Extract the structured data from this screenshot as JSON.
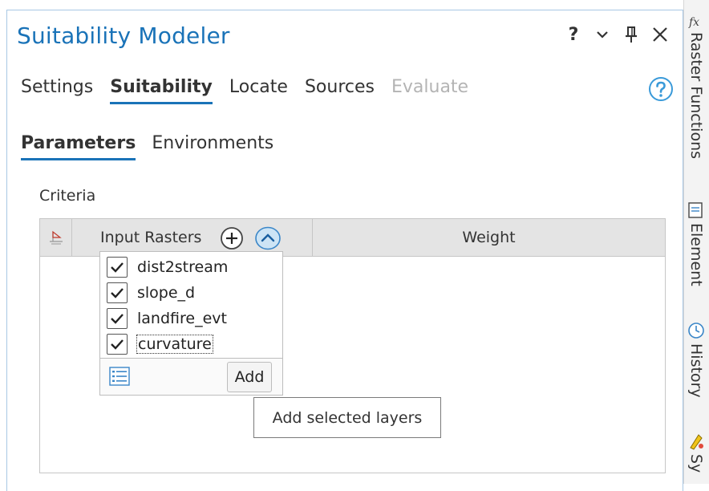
{
  "pane": {
    "title": "Suitability Modeler",
    "controls": {
      "help": "?",
      "menu": "chevron-down-icon",
      "pin": "pin-icon",
      "close": "close-icon"
    }
  },
  "tabs": [
    {
      "label": "Settings",
      "state": "normal"
    },
    {
      "label": "Suitability",
      "state": "active"
    },
    {
      "label": "Locate",
      "state": "normal"
    },
    {
      "label": "Sources",
      "state": "normal"
    },
    {
      "label": "Evaluate",
      "state": "disabled"
    }
  ],
  "subtabs": [
    {
      "label": "Parameters",
      "state": "active"
    },
    {
      "label": "Environments",
      "state": "normal"
    }
  ],
  "criteria": {
    "label": "Criteria",
    "columns": {
      "input_rasters": "Input Rasters",
      "weight": "Weight"
    }
  },
  "dropdown": {
    "items": [
      {
        "label": "dist2stream",
        "checked": true
      },
      {
        "label": "slope_d",
        "checked": true
      },
      {
        "label": "landfire_evt",
        "checked": true
      },
      {
        "label": "curvature",
        "checked": true,
        "focused": true
      }
    ],
    "add_label": "Add"
  },
  "tooltip": {
    "text": "Add selected layers"
  },
  "side_tabs": [
    {
      "label": "Raster Functions",
      "icon": "fx-icon"
    },
    {
      "label": "Element",
      "icon": "element-icon"
    },
    {
      "label": "History",
      "icon": "history-icon"
    },
    {
      "label": "Sy",
      "icon": "symbology-icon"
    }
  ],
  "colors": {
    "accent": "#1a73b8",
    "help_icon": "#3a9ad9",
    "disabled_text": "#b4b4b4",
    "header_bg": "#e4e4e4"
  }
}
